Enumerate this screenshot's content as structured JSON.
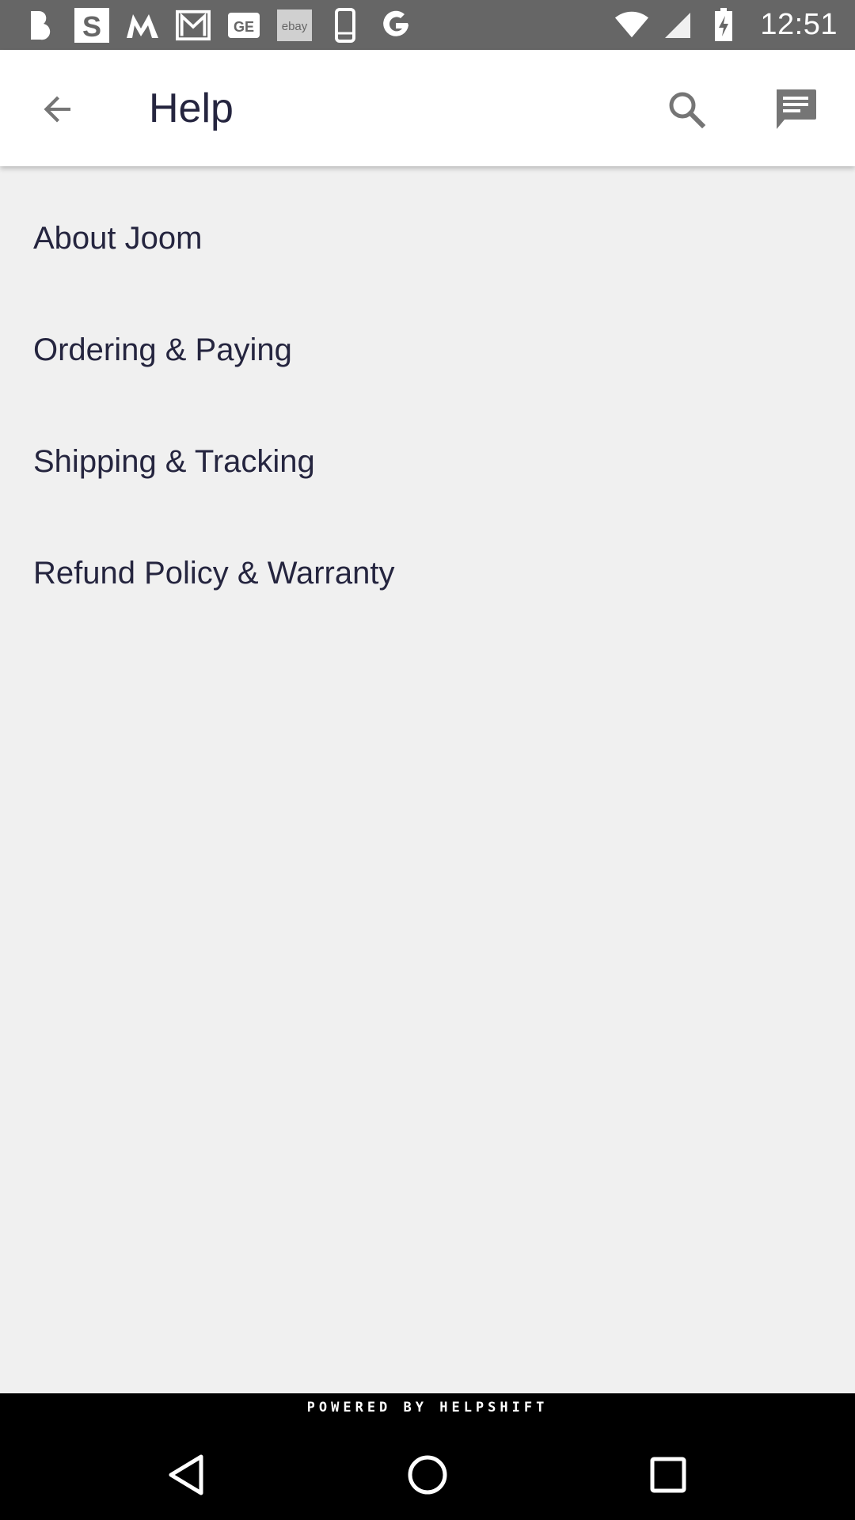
{
  "status_bar": {
    "time": "12:51",
    "notification_icons": [
      "b-icon",
      "s-icon",
      "m-icon",
      "gmail-icon",
      "ge-icon",
      "ebay-icon",
      "phone-icon",
      "google-icon"
    ],
    "ebay_label": "ebay",
    "ge_label": "GE"
  },
  "app_bar": {
    "title": "Help",
    "back_icon": "arrow-back-icon",
    "search_icon": "search-icon",
    "chat_icon": "chat-icon"
  },
  "help_topics": [
    {
      "label": "About Joom"
    },
    {
      "label": "Ordering & Paying"
    },
    {
      "label": "Shipping & Tracking"
    },
    {
      "label": "Refund Policy & Warranty"
    }
  ],
  "footer": {
    "powered_by": "POWERED BY HELPSHIFT"
  },
  "navigation_bar": {
    "buttons": [
      "nav-back-icon",
      "nav-home-icon",
      "nav-recents-icon"
    ]
  },
  "colors": {
    "status_bar": "#666666",
    "app_bar": "#ffffff",
    "background": "#f0f0f0",
    "text": "#25253f",
    "icon": "#757575",
    "footer": "#000000"
  }
}
